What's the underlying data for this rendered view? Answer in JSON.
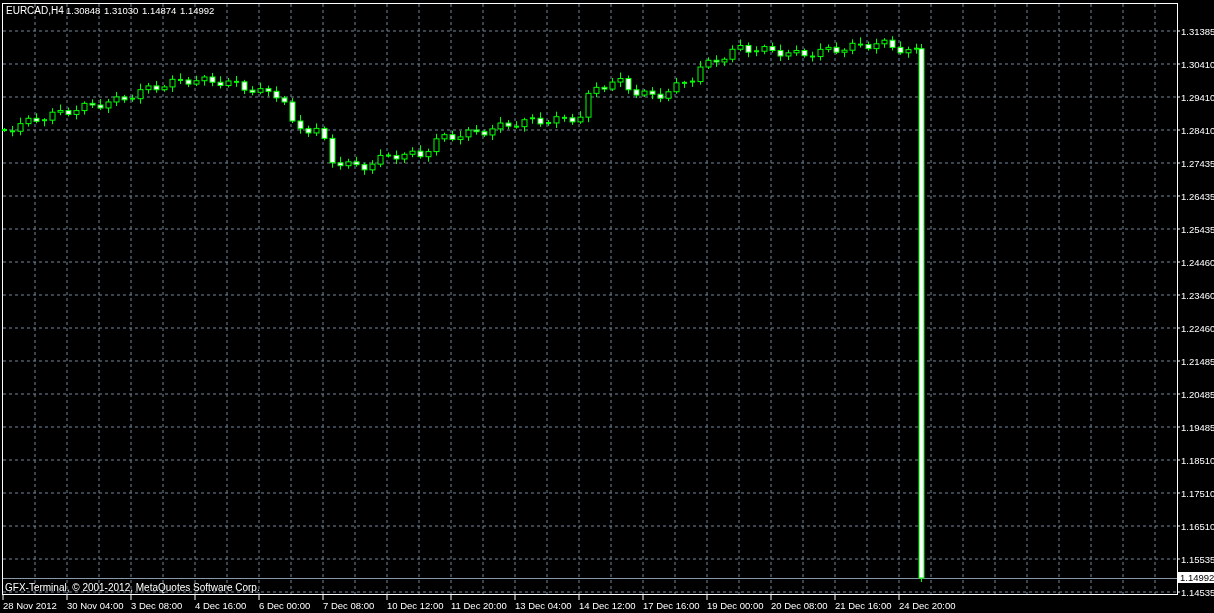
{
  "chart": {
    "symbol": "EURCAD,H4",
    "quotes": [
      "1.30848",
      "1.31030",
      "1.14874",
      "1.14992"
    ],
    "price_labels": [
      "1.31385",
      "1.30410",
      "1.29410",
      "1.28410",
      "1.27435",
      "1.26435",
      "1.25435",
      "1.24460",
      "1.23460",
      "1.22460",
      "1.21485",
      "1.20485",
      "1.19485",
      "1.18510",
      "1.17510",
      "1.16510",
      "1.15535",
      "1.14535"
    ],
    "current_price": "1.14992",
    "time_labels": [
      "28 Nov 2012",
      "30 Nov 04:00",
      "3 Dec 08:00",
      "4 Dec 16:00",
      "6 Dec 00:00",
      "7 Dec 08:00",
      "10 Dec 12:00",
      "11 Dec 20:00",
      "13 Dec 04:00",
      "14 Dec 12:00",
      "17 Dec 16:00",
      "19 Dec 00:00",
      "20 Dec 08:00",
      "21 Dec 16:00",
      "24 Dec 20:00"
    ],
    "copyright": "GFX-Terminal, © 2001-2012, MetaQuotes Software Corp."
  }
}
